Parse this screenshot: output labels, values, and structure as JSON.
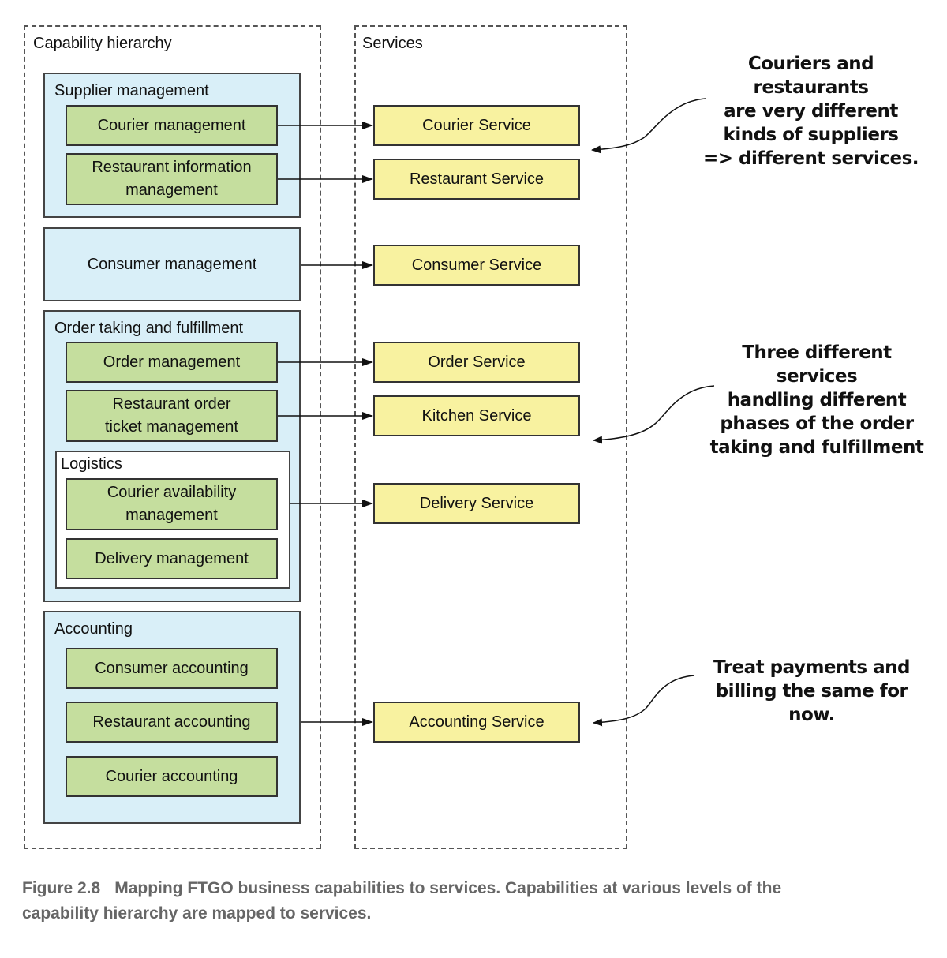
{
  "panels": {
    "capability_title": "Capability hierarchy",
    "services_title": "Services"
  },
  "capabilities": {
    "supplier": {
      "label": "Supplier management",
      "courier": "Courier management",
      "restaurant_info_line1": "Restaurant information",
      "restaurant_info_line2": "management"
    },
    "consumer": {
      "label": "Consumer management"
    },
    "order": {
      "label": "Order taking and fulfillment",
      "order_mgmt": "Order management",
      "ticket_line1": "Restaurant order",
      "ticket_line2": "ticket management",
      "logistics": {
        "label": "Logistics",
        "availability_line1": "Courier availability",
        "availability_line2": "management",
        "delivery": "Delivery management"
      }
    },
    "accounting": {
      "label": "Accounting",
      "consumer": "Consumer accounting",
      "restaurant": "Restaurant accounting",
      "courier": "Courier accounting"
    }
  },
  "services": {
    "courier": "Courier Service",
    "restaurant": "Restaurant Service",
    "consumer": "Consumer Service",
    "order": "Order Service",
    "kitchen": "Kitchen Service",
    "delivery": "Delivery Service",
    "accounting": "Accounting Service"
  },
  "notes": {
    "suppliers": [
      "Couriers and restaurants",
      "are very different",
      "kinds of suppliers",
      "=> different services."
    ],
    "order": [
      "Three different services",
      "handling different",
      "phases of the order",
      "taking and fulfillment"
    ],
    "accounting": [
      "Treat payments and",
      "billing the same for now."
    ]
  },
  "caption": {
    "figure": "Figure 2.8",
    "line1": "Mapping FTGO business capabilities to services. Capabilities at various levels of the",
    "line2": "capability hierarchy are mapped to services."
  },
  "colors": {
    "group_fill": "#d9eff8",
    "capability_fill": "#c5de9e",
    "service_fill": "#f8f2a0",
    "caption_text": "#666666"
  }
}
